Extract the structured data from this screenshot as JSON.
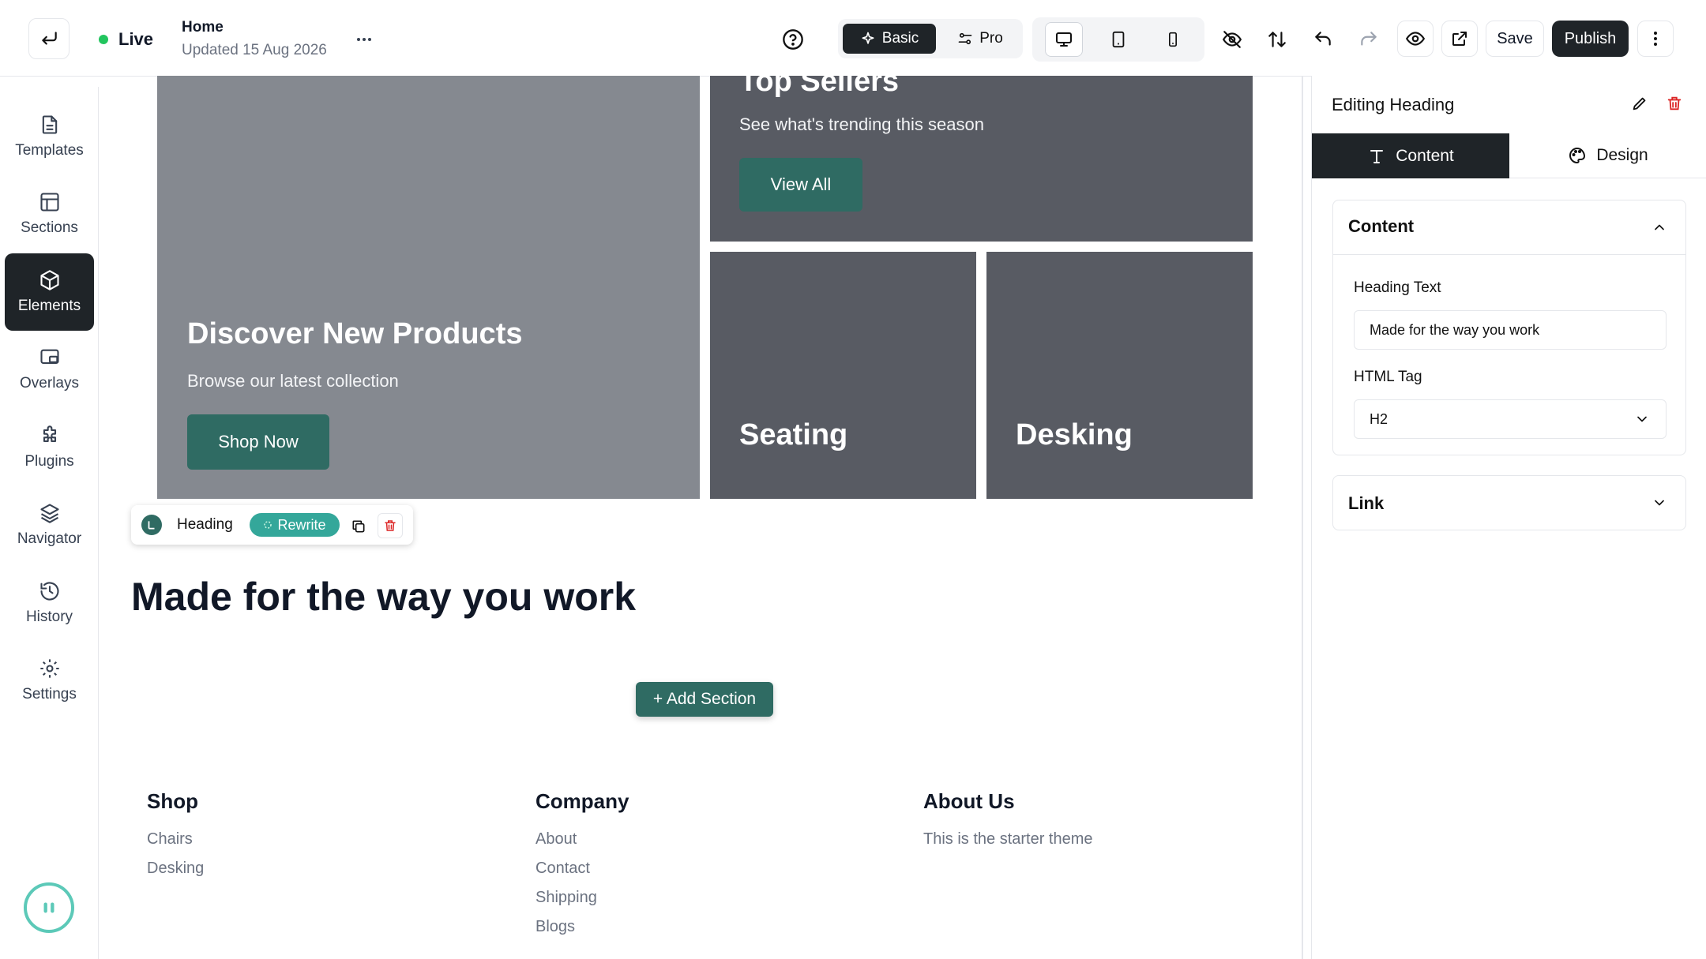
{
  "topbar": {
    "status": "Live",
    "page_name": "Home",
    "updated": "Updated 15 Aug 2026",
    "mode_basic": "Basic",
    "mode_pro": "Pro",
    "save_label": "Save",
    "publish_label": "Publish"
  },
  "sidebar": {
    "items": [
      {
        "label": "Templates",
        "icon": "file-icon"
      },
      {
        "label": "Sections",
        "icon": "layout-icon"
      },
      {
        "label": "Elements",
        "icon": "cube-icon"
      },
      {
        "label": "Overlays",
        "icon": "overlay-icon"
      },
      {
        "label": "Plugins",
        "icon": "puzzle-icon"
      },
      {
        "label": "Navigator",
        "icon": "layers-icon"
      },
      {
        "label": "History",
        "icon": "history-icon"
      },
      {
        "label": "Settings",
        "icon": "gear-icon"
      }
    ]
  },
  "canvas": {
    "hero_title": "Discover New Products",
    "hero_sub": "Browse our latest collection",
    "hero_btn": "Shop Now",
    "top_title": "Top Sellers",
    "top_sub": "See what's trending this season",
    "top_btn": "View All",
    "tile_seating": "Seating",
    "tile_desking": "Desking",
    "toolbar_label": "Heading",
    "toolbar_rewrite": "Rewrite",
    "heading": "Made for the way you work",
    "add_section": "+ Add Section",
    "footer": {
      "shop_title": "Shop",
      "shop_links": [
        "Chairs",
        "Desking"
      ],
      "company_title": "Company",
      "company_links": [
        "About",
        "Contact",
        "Shipping",
        "Blogs"
      ],
      "about_title": "About Us",
      "about_text": "This is the starter theme"
    }
  },
  "panel": {
    "title": "Editing Heading",
    "tab_content": "Content",
    "tab_design": "Design",
    "section_content": "Content",
    "heading_text_label": "Heading Text",
    "heading_text_value": "Made for the way you work",
    "html_tag_label": "HTML Tag",
    "html_tag_value": "H2",
    "section_link": "Link"
  },
  "colors": {
    "accent": "#2f6b63",
    "live_dot": "#22c55e",
    "dark": "#1f2428",
    "danger": "#dc2626",
    "tile_light": "#858990",
    "tile_dark": "#585b63"
  }
}
